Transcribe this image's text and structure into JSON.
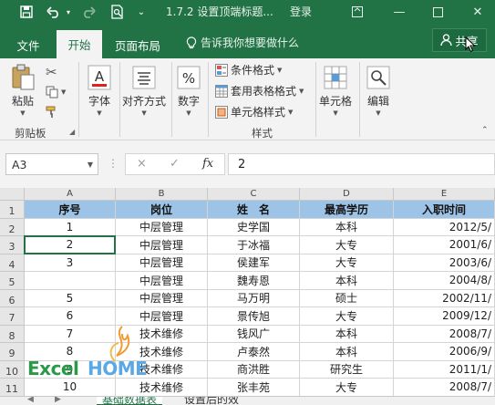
{
  "titlebar": {
    "title": "1.7.2 设置顶端标题...",
    "login": "登录",
    "icons": [
      "save-icon",
      "undo-icon",
      "redo-icon",
      "print-preview-icon",
      "customize-icon"
    ]
  },
  "tabs": {
    "file": "文件",
    "home": "开始",
    "page_layout": "页面布局",
    "tell_me": "告诉我你想要做什么",
    "share": "共享"
  },
  "ribbon": {
    "paste": "粘贴",
    "clipboard": "剪贴板",
    "font": "字体",
    "alignment": "对齐方式",
    "number": "数字",
    "conditional_format": "条件格式",
    "table_format": "套用表格格式",
    "cell_style": "单元格样式",
    "styles": "样式",
    "cells": "单元格",
    "editing": "编辑",
    "font_icon_letter": "A",
    "number_icon_symbol": "%"
  },
  "formula_bar": {
    "name_box": "A3",
    "cancel": "×",
    "enter": "✓",
    "fx": "fx",
    "value": "2"
  },
  "grid": {
    "columns": [
      "A",
      "B",
      "C",
      "D",
      "E"
    ],
    "row_numbers": [
      "1",
      "2",
      "3",
      "4",
      "5",
      "6",
      "7",
      "8",
      "9",
      "10",
      "11"
    ],
    "rows": [
      [
        "序号",
        "岗位",
        "姓　名",
        "最高学历",
        "入职时间"
      ],
      [
        "1",
        "中层管理",
        "史学国",
        "本科",
        "2012/5/"
      ],
      [
        "2",
        "中层管理",
        "于冰福",
        "大专",
        "2001/6/"
      ],
      [
        "3",
        "中层管理",
        "侯建军",
        "大专",
        "2003/6/"
      ],
      [
        "",
        "中层管理",
        "魏寿恩",
        "本科",
        "2004/8/"
      ],
      [
        "5",
        "中层管理",
        "马万明",
        "硕士",
        "2002/11/"
      ],
      [
        "6",
        "中层管理",
        "景传旭",
        "大专",
        "2009/12/"
      ],
      [
        "7",
        "技术维修",
        "钱风广",
        "本科",
        "2008/7/"
      ],
      [
        "8",
        "技术维修",
        "卢泰然",
        "本科",
        "2006/9/"
      ],
      [
        "9",
        "技术维修",
        "商洪胜",
        "研究生",
        "2011/1/"
      ],
      [
        "10",
        "技术维修",
        "张丰苑",
        "大专",
        "2008/7/"
      ]
    ]
  },
  "watermark": {
    "excel": "Excel",
    "home": "HOME"
  },
  "sheets": [
    "基础数据表",
    "设置后的效"
  ],
  "colors": {
    "accent": "#217346",
    "header_fill": "#9dc3e6"
  }
}
